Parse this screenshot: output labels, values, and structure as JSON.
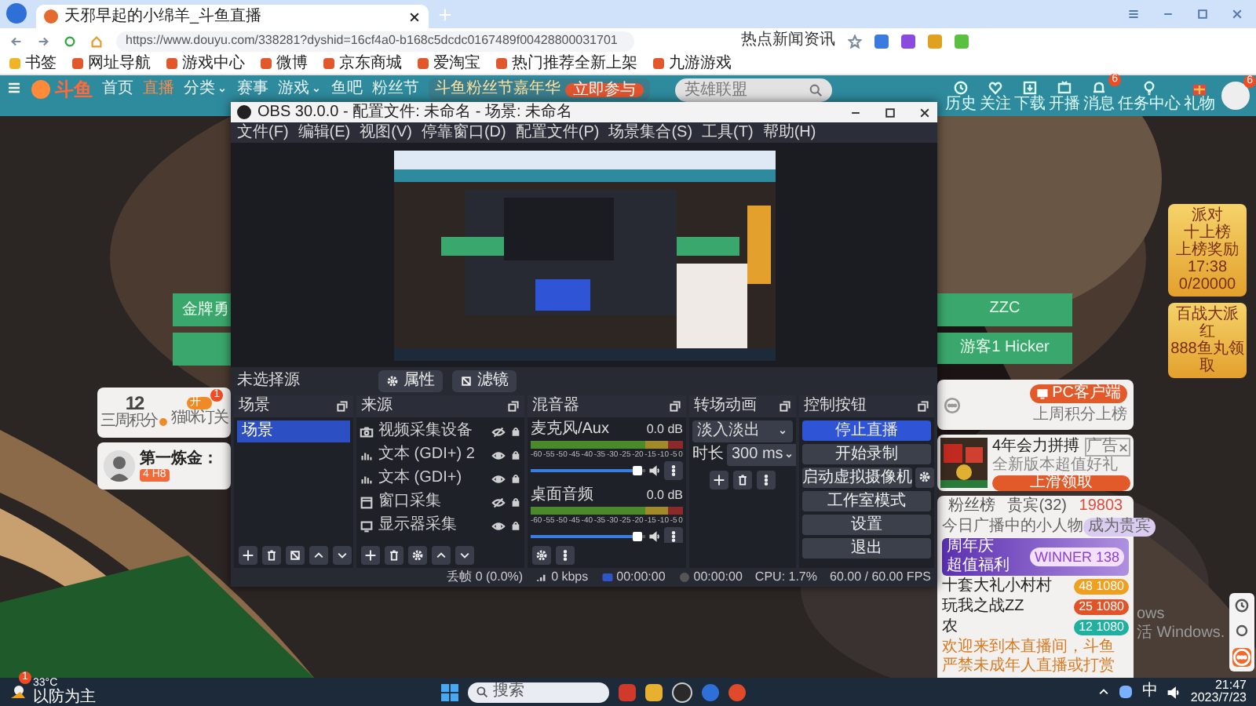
{
  "browser": {
    "tab": {
      "title": "天邪早起的小绵羊_斗鱼直播"
    },
    "address": "https://www.douyu.com/338281?dyshid=16cf4a0-b168c5dcdc0167489f00428800031701",
    "hint": "热点新闻资讯",
    "bookmarks": [
      "书签",
      "网址导航",
      "游戏中心",
      "微博",
      "京东商城",
      "爱淘宝",
      "热门推荐全新上架",
      "九游游戏"
    ]
  },
  "site": {
    "logo": "斗鱼",
    "nav": [
      {
        "label": "首页",
        "selected": false,
        "dropdown": false
      },
      {
        "label": "直播",
        "selected": true,
        "dropdown": false
      },
      {
        "label": "分类",
        "selected": false,
        "dropdown": true
      },
      {
        "label": "赛事",
        "selected": false,
        "dropdown": false
      },
      {
        "label": "游戏",
        "selected": false,
        "dropdown": true
      },
      {
        "label": "鱼吧",
        "selected": false,
        "dropdown": false
      },
      {
        "label": "粉丝节",
        "selected": false,
        "dropdown": false
      }
    ],
    "banner": {
      "title": "斗鱼粉丝节嘉年华",
      "button": "立即参与"
    },
    "search": {
      "placeholder": "英雄联盟"
    },
    "actions": [
      {
        "label": "历史",
        "kind": "history"
      },
      {
        "label": "关注",
        "kind": "follow"
      },
      {
        "label": "下载",
        "kind": "download"
      },
      {
        "label": "开播",
        "kind": "broadcast"
      },
      {
        "label": "消息",
        "kind": "message",
        "badge": "6"
      },
      {
        "label": "任务中心",
        "kind": "task"
      },
      {
        "label": "礼物",
        "kind": "gift"
      }
    ],
    "avatar_badge": "6"
  },
  "page": {
    "left_buttons": [
      "金牌勇"
    ],
    "right_buttons": [
      "ZZC",
      "游客1 Hicker"
    ],
    "points": {
      "value": "12",
      "label": "三周积分",
      "switch_text": "开",
      "switch_on": true,
      "switch_badge": "1",
      "switch_label": "猫咪订关"
    },
    "anchor": {
      "name": "第一炼金：",
      "tag": "4 H8"
    },
    "client": {
      "button": "PC客户端",
      "note": "上周积分上榜"
    },
    "ad": {
      "title": "4年会力拼搏",
      "subtitle": "全新版本超值好礼",
      "tag": "广告",
      "button": "上滑领取"
    },
    "rank": {
      "tabs": [
        {
          "label": "粉丝榜",
          "selected": false
        },
        {
          "label": "贵宾(32)",
          "selected": false
        },
        {
          "label": "19803",
          "selected": true
        }
      ],
      "notice": "今日广播中的小人物",
      "notice_button": "成为贵宾",
      "promo": {
        "title": "周年庆",
        "subtitle": "超值福利",
        "badge": "WINNER 138"
      },
      "rows": [
        {
          "name": "十套大礼小村村",
          "badge": "48 1080",
          "color": "#f0a020"
        },
        {
          "name": "玩我之战ZZ",
          "badge": "25 1080",
          "color": "#e0542a"
        },
        {
          "name": "农",
          "badge": "12 1080",
          "color": "#1fb0a0"
        }
      ],
      "footer": "欢迎来到本直播间，斗鱼严禁未成年人直播或打赏"
    },
    "rail": [
      {
        "lines": [
          "派对",
          "十上榜",
          "上榜奖励 17:38",
          "0/20000"
        ]
      },
      {
        "lines": [
          "百战大派红",
          "888鱼丸领取"
        ]
      }
    ],
    "activation": [
      "ows",
      "活 Windows."
    ]
  },
  "obs": {
    "title": "OBS 30.0.0 - 配置文件: 未命名 - 场景: 未命名",
    "menu": [
      "文件(F)",
      "编辑(E)",
      "视图(V)",
      "停靠窗口(D)",
      "配置文件(P)",
      "场景集合(S)",
      "工具(T)",
      "帮助(H)"
    ],
    "source_status": "未选择源",
    "tool_buttons": [
      {
        "label": "属性",
        "kind": "gear"
      },
      {
        "label": "滤镜",
        "kind": "filter"
      }
    ],
    "scenes": {
      "title": "场景",
      "items": [
        {
          "label": "场景",
          "selected": true
        }
      ]
    },
    "sources": {
      "title": "来源",
      "items": [
        {
          "label": "视频采集设备",
          "kind": "camera",
          "visible": false
        },
        {
          "label": "文本 (GDI+) 2",
          "kind": "text",
          "visible": true
        },
        {
          "label": "文本 (GDI+)",
          "kind": "text",
          "visible": true
        },
        {
          "label": "窗口采集",
          "kind": "window",
          "visible": false
        },
        {
          "label": "显示器采集",
          "kind": "display",
          "visible": true
        }
      ]
    },
    "mixer": {
      "title": "混音器",
      "tracks": [
        {
          "name": "麦克风/Aux",
          "reading": "0.0 dB",
          "level": 0.93,
          "scale": [
            "-60",
            "-55",
            "-50",
            "-45",
            "-40",
            "-35",
            "-30",
            "-25",
            "-20",
            "-15",
            "-10",
            "-5",
            "0"
          ]
        },
        {
          "name": "桌面音频",
          "reading": "0.0 dB",
          "level": 0.93,
          "scale": [
            "-60",
            "-55",
            "-50",
            "-45",
            "-40",
            "-35",
            "-30",
            "-25",
            "-20",
            "-15",
            "-10",
            "-5",
            "0"
          ]
        }
      ]
    },
    "transitions": {
      "title": "转场动画",
      "type": "淡入淡出",
      "duration_label": "时长",
      "duration": "300 ms"
    },
    "controls": {
      "title": "控制按钮",
      "buttons": [
        {
          "label": "停止直播",
          "active": true,
          "settings": false
        },
        {
          "label": "开始录制",
          "active": false,
          "settings": false
        },
        {
          "label": "启动虚拟摄像机",
          "active": false,
          "settings": true
        },
        {
          "label": "工作室模式",
          "active": false,
          "settings": false
        },
        {
          "label": "设置",
          "active": false,
          "settings": false
        },
        {
          "label": "退出",
          "active": false,
          "settings": false
        }
      ]
    },
    "status": [
      {
        "text": "丢帧 0 (0.0%)",
        "kind": "plain"
      },
      {
        "text": "0 kbps",
        "kind": "signal"
      },
      {
        "text": "00:00:00",
        "kind": "live"
      },
      {
        "text": "00:00:00",
        "kind": "rec"
      },
      {
        "text": "CPU: 1.7%",
        "kind": "plain"
      },
      {
        "text": "60.00 / 60.00 FPS",
        "kind": "plain"
      }
    ]
  },
  "taskbar": {
    "weather": {
      "temp": "33°C",
      "note": "以防为主",
      "badge": "1"
    },
    "search": {
      "placeholder": "搜索"
    },
    "ime": "中",
    "time": "21:47",
    "date": "2023/7/23"
  }
}
